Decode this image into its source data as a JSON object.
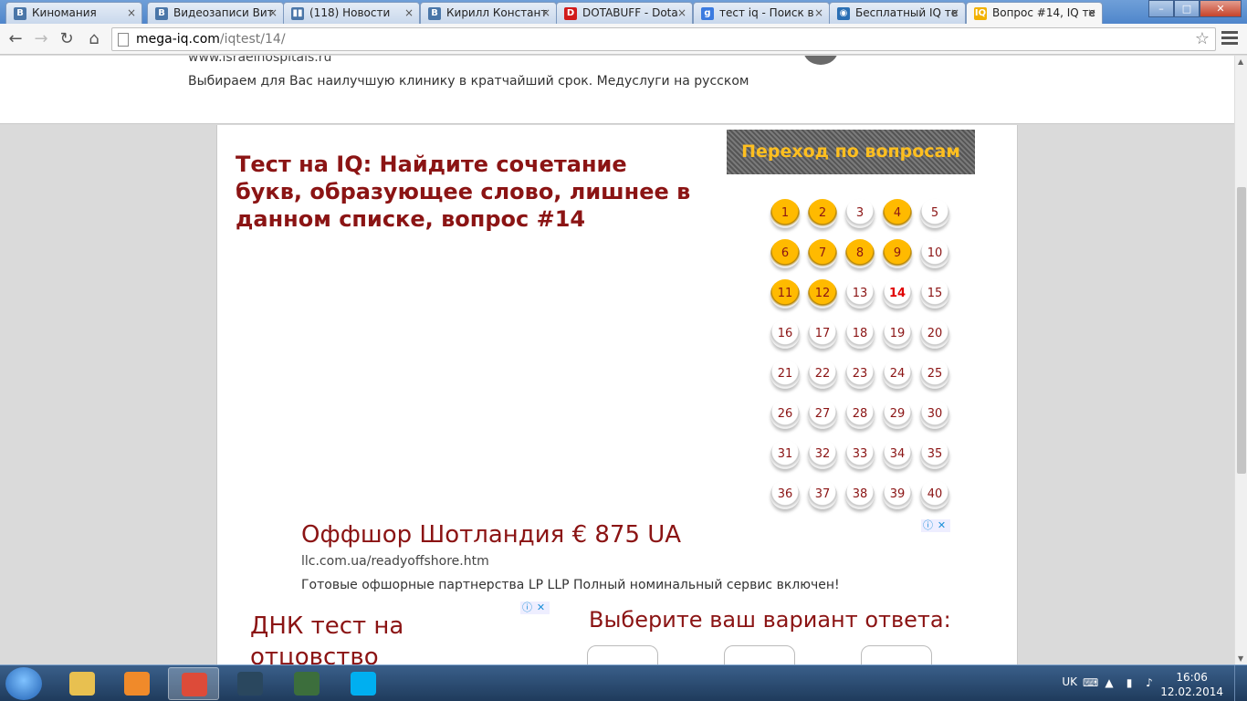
{
  "tabs": [
    {
      "label": "Киномания",
      "icon": "vk-icon",
      "favicon_text": "В",
      "color": "#4a76a8"
    },
    {
      "label": "Видеозаписи Вит",
      "icon": "vk-icon",
      "favicon_text": "В",
      "color": "#4a76a8"
    },
    {
      "label": "(118) Новости",
      "icon": "pause-icon",
      "favicon_text": "▮▮",
      "color": "#4a76a8"
    },
    {
      "label": "Кирилл Констант",
      "icon": "vk-icon",
      "favicon_text": "В",
      "color": "#4a76a8"
    },
    {
      "label": "DOTABUFF - Dota",
      "icon": "dotabuff-icon",
      "favicon_text": "D",
      "color": "#d11b1b"
    },
    {
      "label": "тест iq - Поиск в",
      "icon": "google-icon",
      "favicon_text": "g",
      "color": "#3b7be0"
    },
    {
      "label": "Бесплатный IQ те",
      "icon": "globe-icon",
      "favicon_text": "◉",
      "color": "#2a6fb4"
    },
    {
      "label": "Вопрос #14, IQ те",
      "icon": "iq-icon",
      "favicon_text": "IQ",
      "color": "#f2b100"
    }
  ],
  "window": {
    "minimize": "–",
    "maximize": "□",
    "close": "✕"
  },
  "toolbar": {
    "back": "←",
    "forward": "→",
    "reload": "↻",
    "home": "⌂",
    "url_host": "mega-iq.com",
    "url_path": "/iqtest/14/",
    "star": "☆"
  },
  "top_ad": {
    "site": "www.israelhospitals.ru",
    "description": "Выбираем для Вас наилучшую клинику в кратчайший срок. Медуслуги на русском"
  },
  "question": {
    "title": "Тест на IQ: Найдите сочетание букв, образующее слово, лишнее в данном списке, вопрос #14"
  },
  "question_nav": {
    "title": "Переход по вопросам",
    "current": 14,
    "answered": [
      1,
      2,
      4,
      6,
      7,
      8,
      9,
      11,
      12
    ],
    "buttons": [
      "1",
      "2",
      "3",
      "4",
      "5",
      "6",
      "7",
      "8",
      "9",
      "10",
      "11",
      "12",
      "13",
      "14",
      "15",
      "16",
      "17",
      "18",
      "19",
      "20",
      "21",
      "22",
      "23",
      "24",
      "25",
      "26",
      "27",
      "28",
      "29",
      "30",
      "31",
      "32",
      "33",
      "34",
      "35",
      "36",
      "37",
      "38",
      "39",
      "40"
    ],
    "answered_color": "#ffba00",
    "text_color": "#8b1414",
    "current_color": "#e00000"
  },
  "ad_offshore": {
    "headline": "Оффшор Шотландия € 875 UA",
    "url": "llc.com.ua/readyoffshore.htm",
    "description": "Готовые офшорные партнерства LP LLP Полный номинальный сервис включен!",
    "info_icon": "ⓘ",
    "close_icon": "✕"
  },
  "ad_dna": {
    "line1": "ДНК тест на",
    "line2": "отцовство",
    "info_icon": "ⓘ",
    "close_icon": "✕"
  },
  "answer_prompt": "Выберите ваш вариант ответа:",
  "taskbar": {
    "items": [
      {
        "name": "explorer-icon",
        "color": "#e8c050"
      },
      {
        "name": "media-player-icon",
        "color": "#f08a2a"
      },
      {
        "name": "chrome-icon",
        "color": "#dd4b39"
      },
      {
        "name": "steam-icon",
        "color": "#2a475e"
      },
      {
        "name": "task-manager-icon",
        "color": "#3c6e3c"
      },
      {
        "name": "skype-icon",
        "color": "#00aff0"
      }
    ],
    "active_index": 2,
    "language": "UK",
    "time": "16:06",
    "date": "12.02.2014"
  },
  "scrollbar": {
    "up": "▲",
    "down": "▼"
  }
}
